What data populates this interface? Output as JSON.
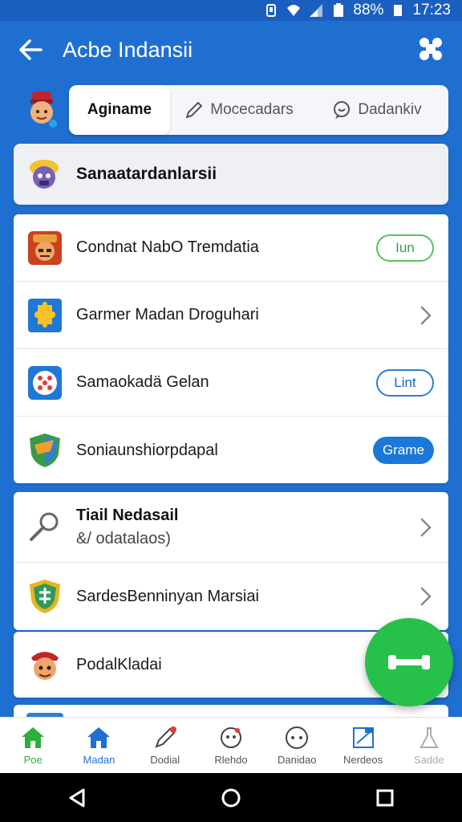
{
  "status_bar": {
    "battery": "88%",
    "time": "17:23"
  },
  "app_bar": {
    "title": "Acbe Indansii"
  },
  "tabs": [
    {
      "label": "Aginame"
    },
    {
      "label": "Mocecadars"
    },
    {
      "label": "Dadankiv"
    }
  ],
  "section_header": {
    "label": "Sanaatardanlarsii"
  },
  "list_card1": [
    {
      "label": "Condnat NabO Tremdatia",
      "badge": "Iun"
    },
    {
      "label": "Garmer Madan Droguhari"
    },
    {
      "label": "Samaokadä Gelan",
      "badge": "Lint"
    },
    {
      "label": "Soniaunshiorpdapal",
      "badge": "Grame"
    }
  ],
  "list_card2": {
    "detail": {
      "title": "Tiail Nedasail",
      "subtitle": "&/ odatalaos)"
    },
    "item": {
      "label": "SardesBenninyan Marsiai"
    }
  },
  "list_card3": {
    "label": "PodalKladai"
  },
  "bottom_nav": [
    {
      "label": "Poe"
    },
    {
      "label": "Madan"
    },
    {
      "label": "Dodial"
    },
    {
      "label": "Rlehdo"
    },
    {
      "label": "Danidao"
    },
    {
      "label": "Nerdeos"
    },
    {
      "label": "Sadde"
    }
  ],
  "colors": {
    "primary": "#1f6fd1",
    "accent_green": "#26c04a",
    "nav_active": "#2fae3e"
  }
}
